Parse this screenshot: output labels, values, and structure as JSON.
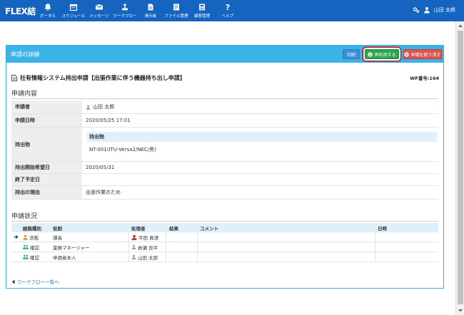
{
  "app": {
    "logo": "FLEX結"
  },
  "nav": [
    {
      "label": "ポータル",
      "icon": "bell-icon"
    },
    {
      "label": "スケジュール",
      "icon": "calendar-icon"
    },
    {
      "label": "メッセージ",
      "icon": "envelope-icon"
    },
    {
      "label": "ワークフロー",
      "icon": "workflow-icon"
    },
    {
      "label": "掲示板",
      "icon": "board-icon"
    },
    {
      "label": "ファイル管理",
      "icon": "folder-icon"
    },
    {
      "label": "顧客管理",
      "icon": "customer-icon"
    },
    {
      "label": "ヘルプ",
      "icon": "help-icon"
    }
  ],
  "user": {
    "name": "山田 太郎"
  },
  "panel": {
    "title": "申請の詳細",
    "print_label": "印刷",
    "reuse_label": "再利用する",
    "withdraw_label": "申請を取り消す"
  },
  "document": {
    "title": "社有情報システム持出申請【出張作業に伴う機器持ち出し申請】",
    "wf_number": "WF番号:164"
  },
  "application": {
    "section_title": "申請内容",
    "rows": [
      {
        "label": "申請者",
        "value": "山田 太郎"
      },
      {
        "label": "申請日時",
        "value": "2020/05/25 17:01"
      },
      {
        "label": "持出物",
        "sub_header": "持出物",
        "sub_value": "NT-001(ITU-Versa2/NEC/黒)"
      },
      {
        "label": "持出開始希望日",
        "value": "2020/05/31"
      },
      {
        "label": "終了予定日",
        "value": ""
      },
      {
        "label": "持出の理由",
        "value": "出張作業のため"
      }
    ]
  },
  "status": {
    "section_title": "申請状況",
    "headers": {
      "type": "経路種別",
      "role": "役割",
      "handler": "処理者",
      "result": "結果",
      "comment": "コメント",
      "datetime": "日時"
    },
    "rows": [
      {
        "type": "決裁",
        "role": "課長",
        "handler": "平田 真澄",
        "result": "",
        "comment": "",
        "datetime": "",
        "current": true
      },
      {
        "type": "確認",
        "role": "業務マネージャー",
        "handler": "岩瀬 良平",
        "result": "",
        "comment": "",
        "datetime": "",
        "current": false
      },
      {
        "type": "確認",
        "role": "申請者本人",
        "handler": "山田 太郎",
        "result": "",
        "comment": "",
        "datetime": "",
        "current": false
      }
    ]
  },
  "back_link": "ワークフロー一覧へ",
  "colors": {
    "topbar": "#1565c0",
    "panel_header": "#3bb3e6",
    "reuse": "#2ea44f",
    "withdraw": "#d9534f",
    "print": "#3d8fd1",
    "highlight": "#d01010"
  }
}
